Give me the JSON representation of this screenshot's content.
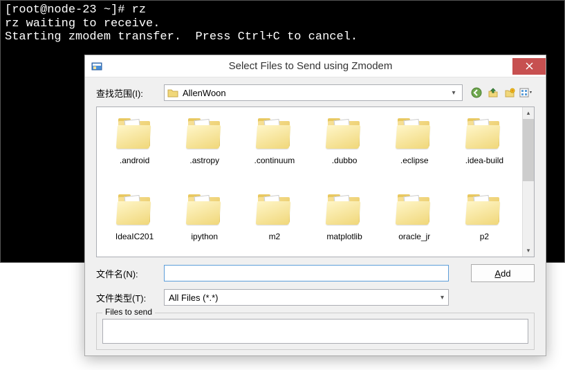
{
  "terminal": {
    "line1_prompt": "[root@node-23 ~]# ",
    "line1_cmd": "rz",
    "line2": "rz waiting to receive.",
    "line3": "Starting zmodem transfer.  Press Ctrl+C to cancel."
  },
  "dialog": {
    "title": "Select Files to Send using Zmodem",
    "lookin_label": "查找范围(I):",
    "lookin_value": "AllenWoon",
    "toolbar": {
      "back": "←",
      "up": "↑",
      "newfolder": "📁",
      "viewmenu": "▦"
    },
    "folders": [
      ".android",
      ".astropy",
      ".continuum",
      ".dubbo",
      ".eclipse",
      ".idea-build",
      "IdeaIC201",
      "ipython",
      "m2",
      "matplotlib",
      "oracle_jr",
      "p2"
    ],
    "filename_label": "文件名(N):",
    "filename_value": "",
    "filetype_label": "文件类型(T):",
    "filetype_value": "All Files (*.*)",
    "add_button": "Add",
    "files_to_send_label": "Files to send"
  }
}
